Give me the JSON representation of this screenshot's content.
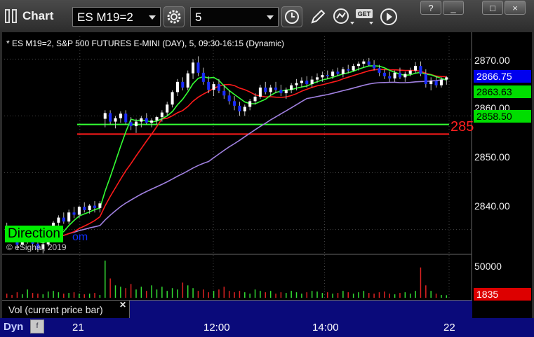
{
  "app": {
    "title": "Chart"
  },
  "toolbar": {
    "symbol": "ES M19=2",
    "interval": "5",
    "icons": [
      "settings-icon",
      "clock-icon",
      "pencil-icon",
      "chart-type-icon",
      "get-data-icon",
      "play-icon"
    ]
  },
  "window_buttons": {
    "help": "?",
    "minimize": "_",
    "maximize": "□",
    "close": "×"
  },
  "chart_info": "* ES M19=2, S&P 500 FUTURES E-MINI (DAY), 5, 09:30-16:15 (Dynamic)",
  "overlay": {
    "green_text": "Direction",
    "link_text": "om"
  },
  "copyright": "© eSignal, 2019",
  "study_label": "Vol (current price bar)",
  "bottom": {
    "dyn_label": "Dyn",
    "dyn_icon": "f"
  },
  "colors": {
    "up_candle": "#ffffff",
    "down_candle": "#1a2cff",
    "green_line": "#33ff33",
    "red_line": "#ff1a1a",
    "purple_line": "#a080e0",
    "volume_up": "#33dd33",
    "volume_down": "#dd2222"
  },
  "chart_data": {
    "type": "candlestick",
    "y_axis": {
      "ticks": [
        "2870.00",
        "2860.00",
        "2850.00",
        "2840.00"
      ],
      "range": [
        2836,
        2874
      ]
    },
    "x_axis": {
      "ticks": [
        "21",
        "12:00",
        "14:00",
        "22"
      ]
    },
    "price_labels": {
      "last": "2866.75",
      "green_ma": "2863.63",
      "level_green": "2858.50",
      "level_red_partial": "285"
    },
    "levels": [
      {
        "color": "green",
        "value": 2858.5
      },
      {
        "color": "red",
        "value": 2856.8
      }
    ],
    "volume": {
      "tick": "50000",
      "current": "1835"
    },
    "candles_ohlc": [
      [
        2840.5,
        2841.2,
        2838.5,
        2839.2
      ],
      [
        2839.2,
        2840.0,
        2838.0,
        2838.6
      ],
      [
        2838.6,
        2839.0,
        2836.5,
        2837.3
      ],
      [
        2837.3,
        2838.5,
        2836.8,
        2838.1
      ],
      [
        2838.1,
        2839.5,
        2837.5,
        2839.0
      ],
      [
        2839.0,
        2839.5,
        2837.0,
        2837.5
      ],
      [
        2837.5,
        2838.2,
        2836.0,
        2836.6
      ],
      [
        2836.6,
        2837.8,
        2835.8,
        2837.4
      ],
      [
        2837.4,
        2839.5,
        2837.0,
        2839.2
      ],
      [
        2839.2,
        2841.5,
        2839.0,
        2841.2
      ],
      [
        2841.2,
        2842.5,
        2840.5,
        2842.1
      ],
      [
        2842.1,
        2843.0,
        2841.0,
        2841.4
      ],
      [
        2841.4,
        2843.5,
        2841.0,
        2843.0
      ],
      [
        2843.0,
        2844.0,
        2842.0,
        2842.6
      ],
      [
        2842.6,
        2844.2,
        2842.0,
        2844.0
      ],
      [
        2844.0,
        2844.8,
        2843.0,
        2843.4
      ],
      [
        2843.4,
        2844.5,
        2842.8,
        2844.2
      ],
      [
        2844.2,
        2845.0,
        2843.0,
        2843.8
      ],
      [
        2843.8,
        2845.0,
        2843.0,
        2844.6
      ],
      [
        2859.5,
        2861.0,
        2858.0,
        2860.5
      ],
      [
        2860.5,
        2861.0,
        2858.5,
        2859.0
      ],
      [
        2859.0,
        2860.0,
        2857.8,
        2859.6
      ],
      [
        2859.6,
        2860.8,
        2858.8,
        2860.4
      ],
      [
        2860.4,
        2861.0,
        2858.5,
        2858.9
      ],
      [
        2858.9,
        2859.8,
        2857.5,
        2858.2
      ],
      [
        2858.2,
        2859.5,
        2857.0,
        2859.0
      ],
      [
        2859.0,
        2860.0,
        2858.0,
        2859.6
      ],
      [
        2859.6,
        2860.5,
        2858.5,
        2858.8
      ],
      [
        2858.8,
        2859.6,
        2858.0,
        2859.2
      ],
      [
        2859.2,
        2860.0,
        2858.5,
        2859.8
      ],
      [
        2859.8,
        2861.0,
        2859.0,
        2860.6
      ],
      [
        2860.6,
        2862.5,
        2860.0,
        2862.0
      ],
      [
        2862.0,
        2864.5,
        2861.5,
        2864.2
      ],
      [
        2864.2,
        2866.5,
        2863.5,
        2866.0
      ],
      [
        2866.0,
        2866.8,
        2864.5,
        2865.0
      ],
      [
        2865.0,
        2868.0,
        2864.5,
        2867.5
      ],
      [
        2867.5,
        2870.0,
        2866.5,
        2869.4
      ],
      [
        2869.4,
        2870.5,
        2867.0,
        2867.6
      ],
      [
        2867.6,
        2868.5,
        2865.5,
        2866.0
      ],
      [
        2866.0,
        2867.0,
        2864.0,
        2864.6
      ],
      [
        2864.6,
        2866.0,
        2863.5,
        2865.6
      ],
      [
        2865.6,
        2866.5,
        2864.0,
        2864.4
      ],
      [
        2864.4,
        2865.5,
        2863.0,
        2863.6
      ],
      [
        2863.6,
        2864.5,
        2862.0,
        2862.6
      ],
      [
        2862.6,
        2863.5,
        2861.0,
        2861.8
      ],
      [
        2861.8,
        2862.5,
        2860.0,
        2860.8
      ],
      [
        2860.8,
        2862.0,
        2860.0,
        2861.6
      ],
      [
        2861.6,
        2863.0,
        2861.0,
        2862.6
      ],
      [
        2862.6,
        2864.0,
        2862.0,
        2863.4
      ],
      [
        2863.4,
        2865.5,
        2863.0,
        2865.0
      ],
      [
        2865.0,
        2866.0,
        2863.8,
        2864.2
      ],
      [
        2864.2,
        2865.5,
        2863.5,
        2865.0
      ],
      [
        2865.0,
        2866.0,
        2864.0,
        2864.6
      ],
      [
        2864.6,
        2865.5,
        2863.5,
        2864.0
      ],
      [
        2864.0,
        2865.0,
        2863.0,
        2864.6
      ],
      [
        2864.6,
        2865.8,
        2864.0,
        2865.4
      ],
      [
        2865.4,
        2866.5,
        2864.5,
        2865.8
      ],
      [
        2865.8,
        2866.8,
        2865.0,
        2866.2
      ],
      [
        2866.2,
        2867.0,
        2865.0,
        2865.6
      ],
      [
        2865.6,
        2867.0,
        2865.0,
        2866.4
      ],
      [
        2866.4,
        2867.5,
        2865.8,
        2866.8
      ],
      [
        2866.8,
        2867.8,
        2866.0,
        2867.2
      ],
      [
        2867.2,
        2868.0,
        2866.5,
        2867.0
      ],
      [
        2867.0,
        2868.2,
        2866.5,
        2867.8
      ],
      [
        2867.8,
        2868.5,
        2867.0,
        2867.4
      ],
      [
        2867.4,
        2868.6,
        2866.8,
        2868.2
      ],
      [
        2868.2,
        2869.0,
        2867.5,
        2868.0
      ],
      [
        2868.0,
        2869.2,
        2867.8,
        2868.8
      ],
      [
        2868.8,
        2869.6,
        2868.0,
        2869.2
      ],
      [
        2869.2,
        2870.0,
        2868.5,
        2869.6
      ],
      [
        2869.6,
        2870.2,
        2868.8,
        2869.0
      ],
      [
        2869.0,
        2869.8,
        2868.0,
        2868.4
      ],
      [
        2868.4,
        2869.0,
        2867.0,
        2867.6
      ],
      [
        2867.6,
        2868.2,
        2866.5,
        2867.0
      ],
      [
        2867.0,
        2867.8,
        2866.0,
        2866.6
      ],
      [
        2866.6,
        2868.0,
        2866.0,
        2867.6
      ],
      [
        2867.6,
        2868.5,
        2866.5,
        2866.8
      ],
      [
        2866.8,
        2867.8,
        2866.0,
        2867.4
      ],
      [
        2867.4,
        2868.5,
        2867.0,
        2868.0
      ],
      [
        2868.0,
        2869.5,
        2867.5,
        2868.8
      ],
      [
        2868.8,
        2869.6,
        2867.0,
        2867.4
      ],
      [
        2867.4,
        2868.2,
        2865.0,
        2865.6
      ],
      [
        2865.6,
        2866.8,
        2864.5,
        2866.2
      ],
      [
        2866.2,
        2867.0,
        2865.0,
        2865.4
      ],
      [
        2865.4,
        2866.8,
        2865.0,
        2866.4
      ],
      [
        2866.4,
        2867.0,
        2865.5,
        2866.8
      ]
    ],
    "volume_values": [
      300,
      200,
      400,
      250,
      600,
      350,
      300,
      250,
      450,
      500,
      400,
      300,
      350,
      400,
      300,
      250,
      300,
      350,
      200,
      2700,
      1400,
      900,
      800,
      700,
      1000,
      600,
      800,
      500,
      900,
      600,
      800,
      500,
      700,
      600,
      1100,
      900,
      700,
      500,
      600,
      400,
      500,
      600,
      800,
      500,
      400,
      500,
      400,
      300,
      600,
      500,
      400,
      500,
      300,
      400,
      350,
      500,
      400,
      300,
      400,
      500,
      450,
      350,
      400,
      300,
      350,
      500,
      400,
      300,
      400,
      500,
      350,
      300,
      400,
      450,
      300,
      250,
      350,
      400,
      300,
      500,
      2200,
      900,
      500,
      300,
      200,
      184
    ]
  }
}
